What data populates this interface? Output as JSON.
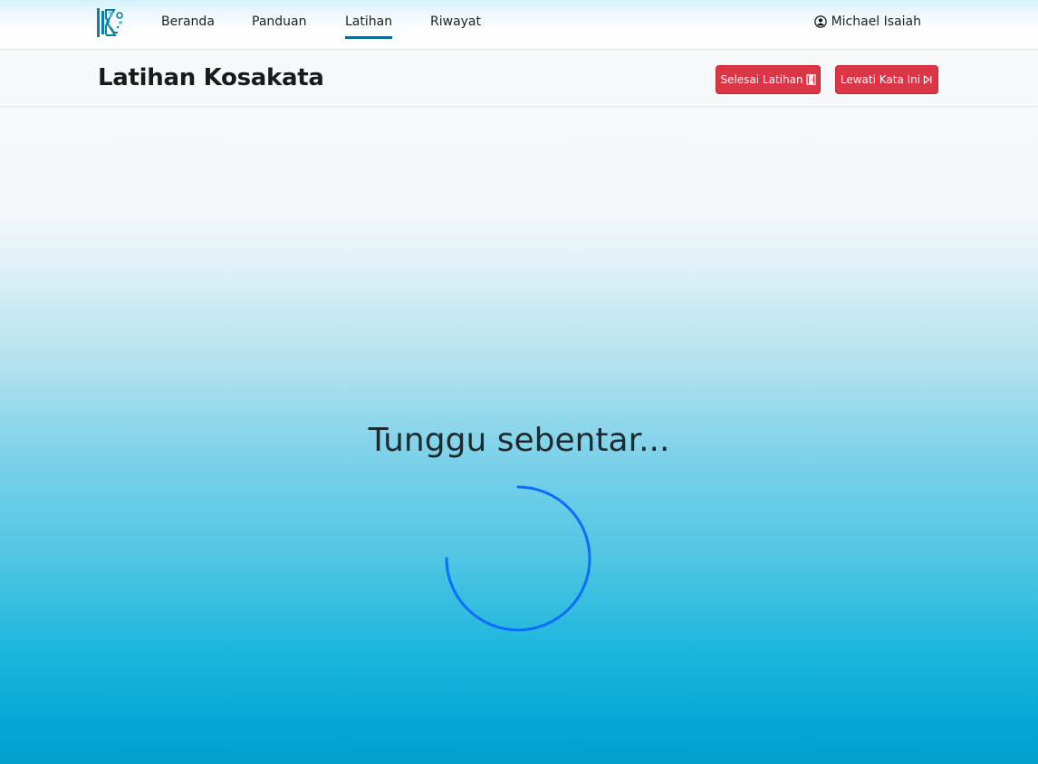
{
  "nav": {
    "items": [
      {
        "label": "Beranda",
        "active": false
      },
      {
        "label": "Panduan",
        "active": false
      },
      {
        "label": "Latihan",
        "active": true
      },
      {
        "label": "Riwayat",
        "active": false
      }
    ],
    "logo_icon": "k-logo-icon",
    "user": {
      "icon": "user-circle-icon",
      "name": "Michael Isaiah"
    }
  },
  "header": {
    "title": "Latihan Kosakata",
    "finish_button": {
      "label": "Selesai Latihan",
      "icon": "door-exit-icon"
    },
    "skip_button": {
      "label": "Lewati Kata Ini",
      "icon": "skip-forward-icon"
    }
  },
  "loading": {
    "text": "Tunggu sebentar...",
    "spinner_icon": "loading-spinner-icon"
  },
  "colors": {
    "accent": "#0b6f95",
    "danger": "#dc3545",
    "spinner": "#0d6efd"
  }
}
